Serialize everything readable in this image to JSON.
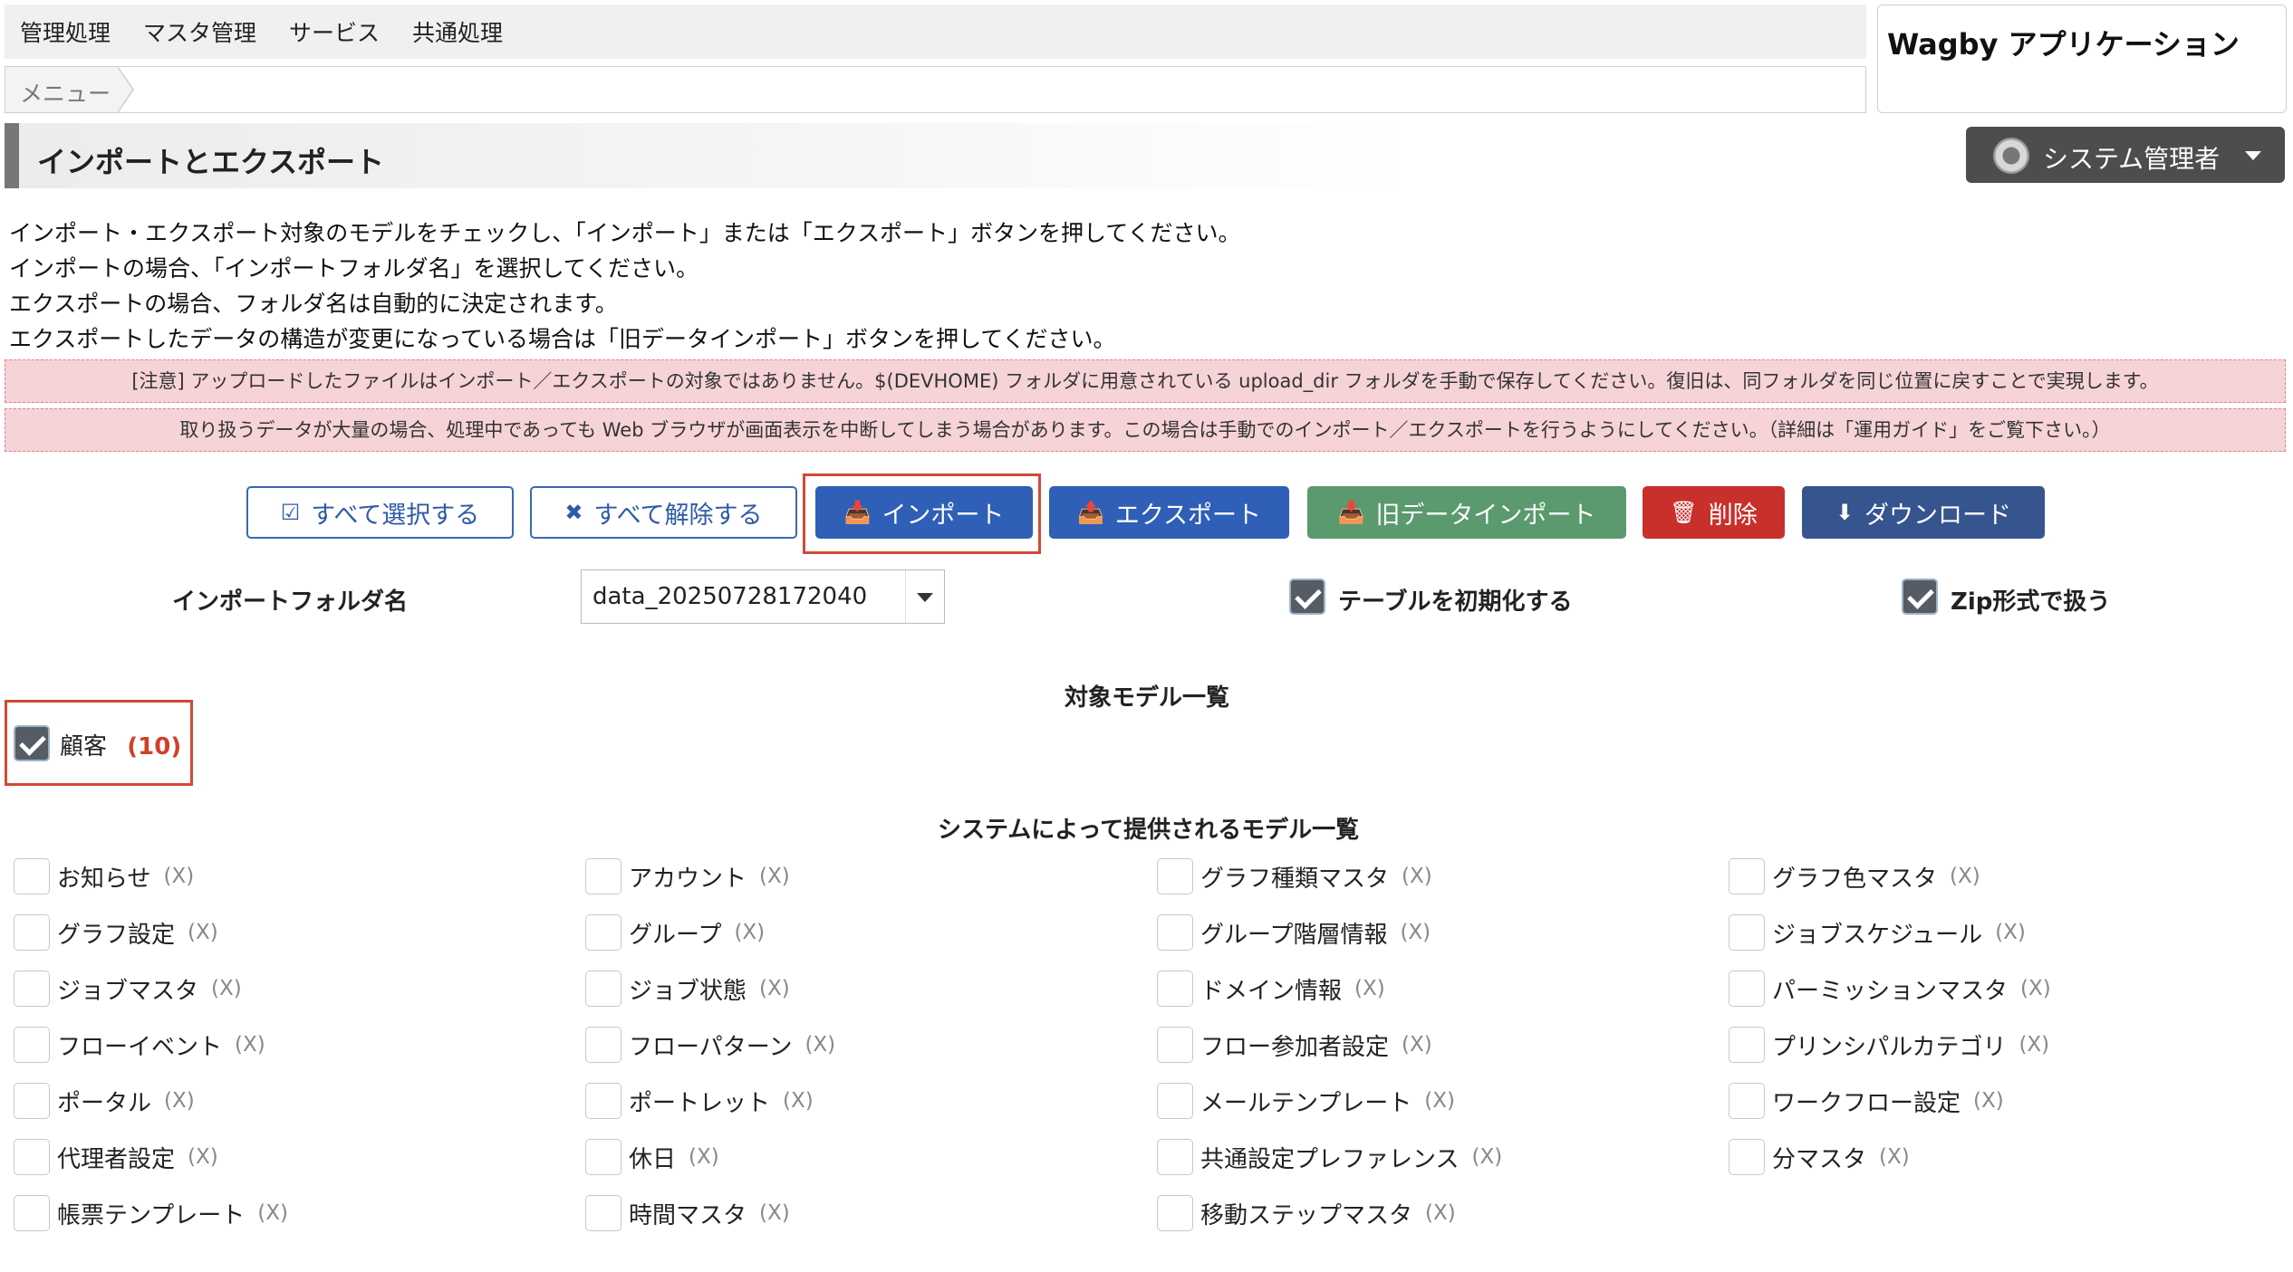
{
  "nav": {
    "items": [
      "管理処理",
      "マスタ管理",
      "サービス",
      "共通処理"
    ],
    "breadcrumb": "メニュー"
  },
  "app": {
    "title": "Wagby アプリケーション"
  },
  "page": {
    "title": "インポートとエクスポート"
  },
  "user": {
    "name": "システム管理者"
  },
  "instructions": [
    "インポート・エクスポート対象のモデルをチェックし、「インポート」または「エクスポート」ボタンを押してください。",
    "インポートの場合、「インポートフォルダ名」を選択してください。",
    "エクスポートの場合、フォルダ名は自動的に決定されます。",
    "エクスポートしたデータの構造が変更になっている場合は「旧データインポート」ボタンを押してください。"
  ],
  "notices": [
    "[注意] アップロードしたファイルはインポート／エクスポートの対象ではありません。$(DEVHOME) フォルダに用意されている upload_dir フォルダを手動で保存してください。復旧は、同フォルダを同じ位置に戻すことで実現します。",
    "取り扱うデータが大量の場合、処理中であっても Web ブラウザが画面表示を中断してしまう場合があります。この場合は手動でのインポート／エクスポートを行うようにしてください。（詳細は「運用ガイド」をご覧下さい。）"
  ],
  "buttons": {
    "select_all": "すべて選択する",
    "deselect_all": "すべて解除する",
    "import": "インポート",
    "export": "エクスポート",
    "legacy_import": "旧データインポート",
    "delete": "削除",
    "download": "ダウンロード"
  },
  "form": {
    "folder_label": "インポートフォルダ名",
    "folder_value": "data_20250728172040",
    "init_table_label": "テーブルを初期化する",
    "init_table_checked": true,
    "zip_label": "Zip形式で扱う",
    "zip_checked": true
  },
  "target_models": {
    "title": "対象モデル一覧",
    "items": [
      {
        "name": "顧客",
        "count": "(10)",
        "checked": true
      }
    ]
  },
  "system_models": {
    "title": "システムによって提供されるモデル一覧",
    "columns": [
      [
        {
          "name": "お知らせ",
          "count": "(X)"
        },
        {
          "name": "グラフ設定",
          "count": "(X)"
        },
        {
          "name": "ジョブマスタ",
          "count": "(X)"
        },
        {
          "name": "フローイベント",
          "count": "(X)"
        },
        {
          "name": "ポータル",
          "count": "(X)"
        },
        {
          "name": "代理者設定",
          "count": "(X)"
        },
        {
          "name": "帳票テンプレート",
          "count": "(X)"
        }
      ],
      [
        {
          "name": "アカウント",
          "count": "(X)"
        },
        {
          "name": "グループ",
          "count": "(X)"
        },
        {
          "name": "ジョブ状態",
          "count": "(X)"
        },
        {
          "name": "フローパターン",
          "count": "(X)"
        },
        {
          "name": "ポートレット",
          "count": "(X)"
        },
        {
          "name": "休日",
          "count": "(X)"
        },
        {
          "name": "時間マスタ",
          "count": "(X)"
        }
      ],
      [
        {
          "name": "グラフ種類マスタ",
          "count": "(X)"
        },
        {
          "name": "グループ階層情報",
          "count": "(X)"
        },
        {
          "name": "ドメイン情報",
          "count": "(X)"
        },
        {
          "name": "フロー参加者設定",
          "count": "(X)"
        },
        {
          "name": "メールテンプレート",
          "count": "(X)"
        },
        {
          "name": "共通設定プレファレンス",
          "count": "(X)"
        },
        {
          "name": "移動ステップマスタ",
          "count": "(X)"
        }
      ],
      [
        {
          "name": "グラフ色マスタ",
          "count": "(X)"
        },
        {
          "name": "ジョブスケジュール",
          "count": "(X)"
        },
        {
          "name": "パーミッションマスタ",
          "count": "(X)"
        },
        {
          "name": "プリンシパルカテゴリ",
          "count": "(X)"
        },
        {
          "name": "ワークフロー設定",
          "count": "(X)"
        },
        {
          "name": "分マスタ",
          "count": "(X)"
        }
      ]
    ]
  },
  "colors": {
    "primary": "#2f5fb7",
    "success": "#5a9a6e",
    "danger": "#c9302c",
    "navy": "#36558f",
    "notice_bg": "#f6d3d7",
    "highlight_frame": "#d04a34",
    "count_red": "#d0402a"
  }
}
